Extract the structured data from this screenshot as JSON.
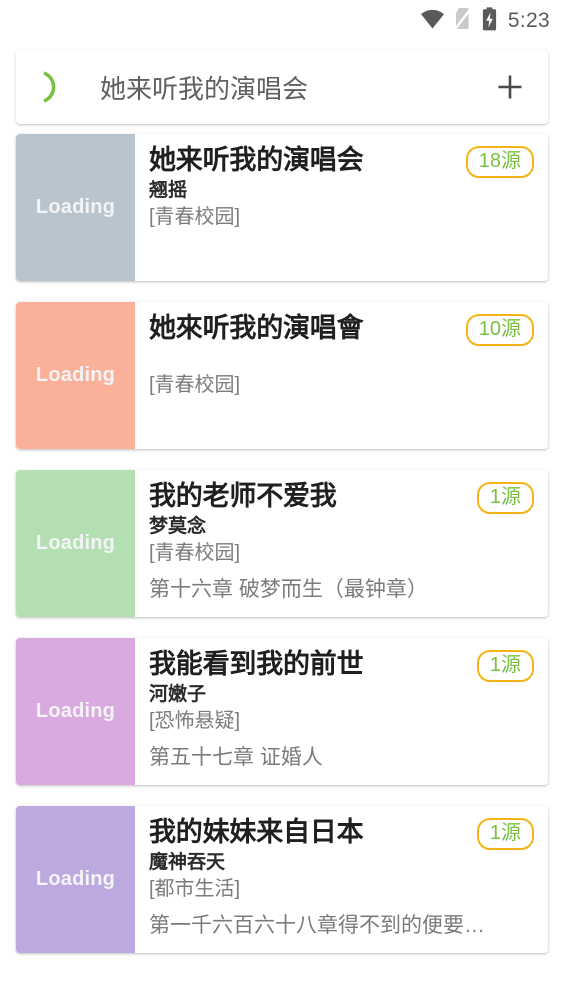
{
  "statusbar": {
    "time": "5:23",
    "icons": [
      "wifi-icon",
      "no-sim-icon",
      "battery-charging-icon"
    ]
  },
  "search": {
    "leading_icon": "loading-arc-icon",
    "query": "她来听我的演唱会",
    "add_icon": "plus-icon",
    "add_label": "+"
  },
  "colors": {
    "badge_border": "#f5b317",
    "badge_text": "#7ac143",
    "accent_green": "#7ac143",
    "title": "#1f1f1f",
    "secondary_text": "#7b7b7b",
    "page_bg": "#ffffff"
  },
  "list": {
    "thumb_placeholder": "Loading",
    "items": [
      {
        "title": "她来听我的演唱会",
        "author": "翘摇",
        "category": "[青春校园]",
        "chapter": "",
        "badge": "18源",
        "thumb_color": "#b8c5ce"
      },
      {
        "title": "她來听我的演唱會",
        "author": "",
        "category": "[青春校园]",
        "chapter": "",
        "badge": "10源",
        "thumb_color": "#fbb09a"
      },
      {
        "title": "我的老师不爱我",
        "author": "梦莫念",
        "category": "[青春校园]",
        "chapter": "第十六章 破梦而生（最钟章）",
        "badge": "1源",
        "thumb_color": "#b3dfb3"
      },
      {
        "title": "我能看到我的前世",
        "author": "河嫩子",
        "category": "[恐怖悬疑]",
        "chapter": "第五十七章 证婚人",
        "badge": "1源",
        "thumb_color": "#d9a9e0"
      },
      {
        "title": "我的妹妹来自日本",
        "author": "魔神吞天",
        "category": "[都市生活]",
        "chapter": "第一千六百六十八章得不到的便要…",
        "badge": "1源",
        "thumb_color": "#bda9e0"
      }
    ]
  }
}
